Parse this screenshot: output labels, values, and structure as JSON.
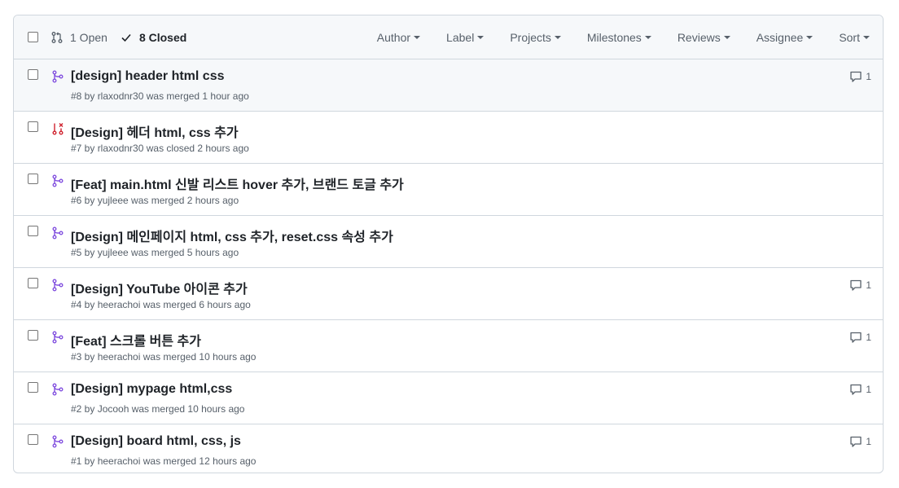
{
  "header": {
    "open_label": "1 Open",
    "closed_label": "8 Closed",
    "filters": [
      "Author",
      "Label",
      "Projects",
      "Milestones",
      "Reviews",
      "Assignee",
      "Sort"
    ]
  },
  "prs": [
    {
      "title": "[design] header html css",
      "meta": "#8 by rlaxodnr30 was merged 1 hour ago",
      "state": "merged",
      "comments": "1"
    },
    {
      "title": "[Design] 헤더 html, css 추가",
      "meta": "#7 by rlaxodnr30 was closed 2 hours ago",
      "state": "closed",
      "comments": ""
    },
    {
      "title": "[Feat] main.html 신발 리스트 hover 추가, 브랜드 토글 추가",
      "meta": "#6 by yujleee was merged 2 hours ago",
      "state": "merged",
      "comments": ""
    },
    {
      "title": "[Design] 메인페이지 html, css 추가, reset.css 속성 추가",
      "meta": "#5 by yujleee was merged 5 hours ago",
      "state": "merged",
      "comments": ""
    },
    {
      "title": "[Design] YouTube 아이콘 추가",
      "meta": "#4 by heerachoi was merged 6 hours ago",
      "state": "merged",
      "comments": "1"
    },
    {
      "title": "[Feat] 스크롤 버튼 추가",
      "meta": "#3 by heerachoi was merged 10 hours ago",
      "state": "merged",
      "comments": "1"
    },
    {
      "title": "[Design] mypage html,css",
      "meta": "#2 by Jocooh was merged 10 hours ago",
      "state": "merged",
      "comments": "1"
    },
    {
      "title": "[Design] board html, css, js",
      "meta": "#1 by heerachoi was merged 12 hours ago",
      "state": "merged",
      "comments": "1"
    }
  ],
  "colors": {
    "merged": "#8250df",
    "closed": "#cf222e"
  }
}
